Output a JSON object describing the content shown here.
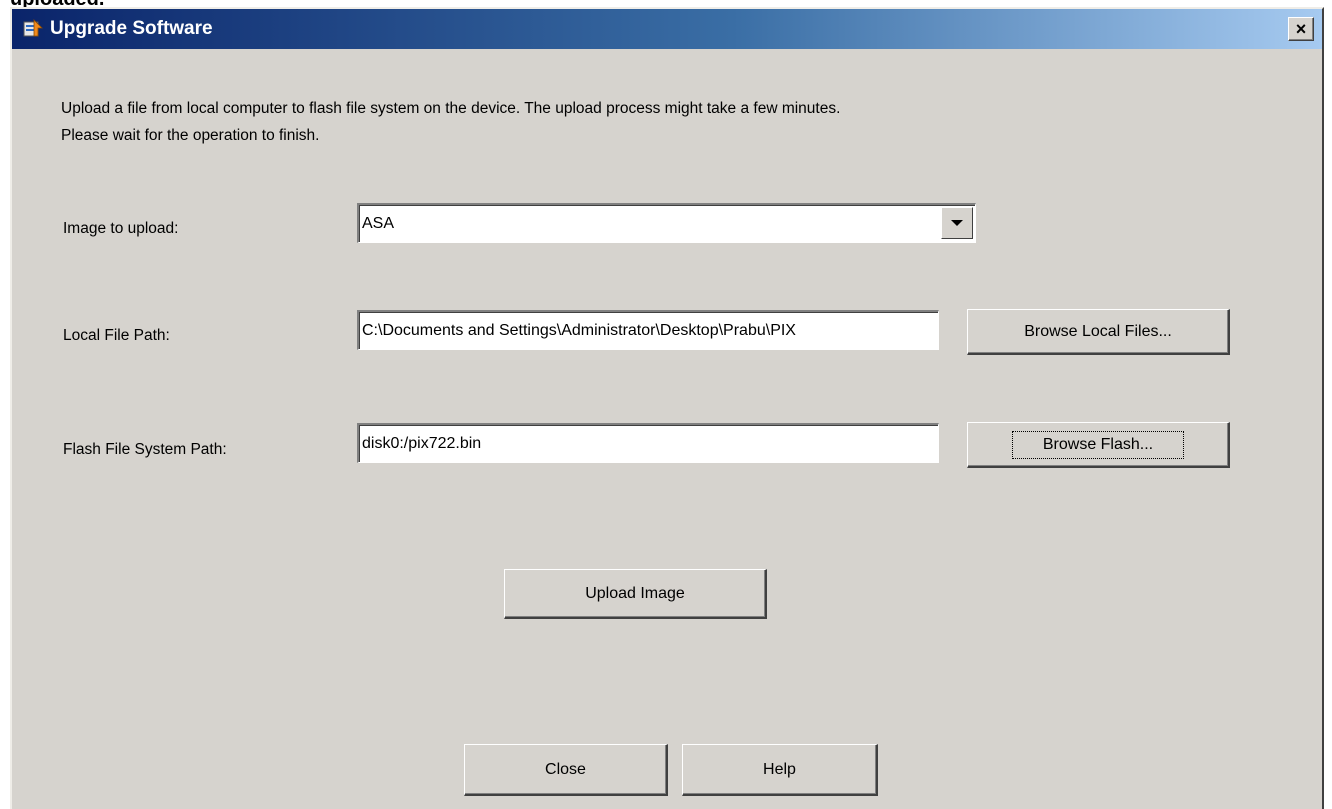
{
  "caption_clipped": "uploaded.",
  "window": {
    "title": "Upgrade Software",
    "close_glyph": "×"
  },
  "description": {
    "line1": "Upload a file from local computer to flash file system on the device. The upload process might take a few minutes.",
    "line2": "Please wait for the operation to finish."
  },
  "image_upload": {
    "label": "Image to upload:",
    "selected": "ASA"
  },
  "local_path": {
    "label": "Local File Path:",
    "value": "C:\\Documents and Settings\\Administrator\\Desktop\\Prabu\\PIX",
    "browse_label": "Browse Local Files..."
  },
  "flash_path": {
    "label": "Flash File System Path:",
    "value": "disk0:/pix722.bin",
    "browse_label": "Browse Flash..."
  },
  "actions": {
    "upload_label": "Upload Image",
    "close_label": "Close",
    "help_label": "Help"
  },
  "colors": {
    "titlebar_start": "#0a246a",
    "titlebar_end": "#a6caf0",
    "dialog_bg": "#d6d3ce"
  },
  "icons": {
    "app": "upgrade-software-icon",
    "close": "close-icon",
    "dropdown": "chevron-down-icon"
  }
}
